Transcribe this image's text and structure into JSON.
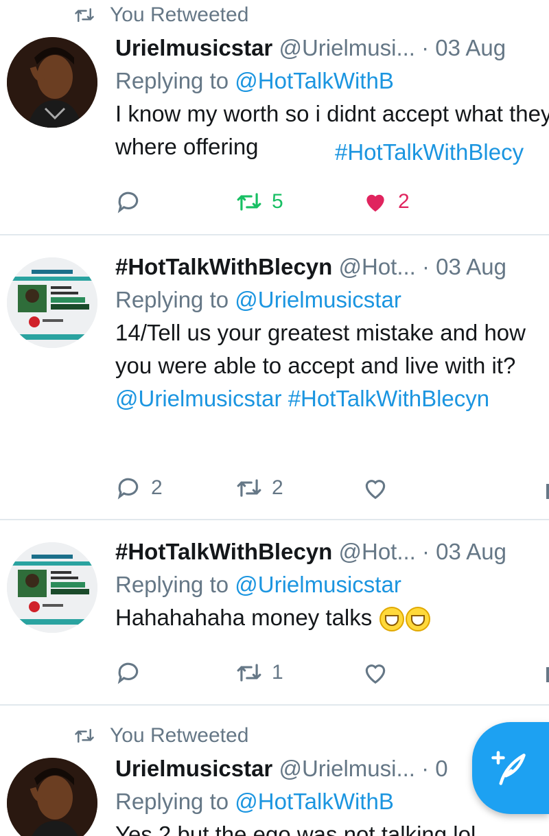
{
  "tweets": [
    {
      "retweeted_label": "You Retweeted",
      "name": "Urielmusicstar",
      "handle": "@Urielmusi...",
      "date": "· 03 Aug",
      "replying_prefix": "Replying to",
      "replying_to": "@HotTalkWithB",
      "text_plain": "I know my worth so i didnt accept what they where offering",
      "text_hashtag": "#HotTalkWithBlecy",
      "reply_count": "",
      "retweet_count": "5",
      "like_count": "2",
      "avatar_icon": "profile-photo-woman",
      "liked": true,
      "retweeted": true
    },
    {
      "name": "#HotTalkWithBlecyn",
      "handle": "@Hot...",
      "date": "· 03 Aug",
      "replying_prefix": "Replying to",
      "replying_to": "@Urielmusicstar",
      "text_plain": "14/Tell us your greatest mistake and how you were able to accept and live with it?",
      "text_mention": "@Urielmusicstar",
      "text_hashtag": "#HotTalkWithBlecyn",
      "reply_count": "2",
      "retweet_count": "2",
      "like_count": "",
      "avatar_icon": "show-flyer-avatar"
    },
    {
      "name": "#HotTalkWithBlecyn",
      "handle": "@Hot...",
      "date": "· 03 Aug",
      "replying_prefix": "Replying to",
      "replying_to": "@Urielmusicstar",
      "text_plain": "Hahahahaha money talks",
      "reply_count": "",
      "retweet_count": "1",
      "like_count": "",
      "avatar_icon": "show-flyer-avatar",
      "emojis": [
        "grinning-squinting-face",
        "grinning-squinting-face"
      ]
    },
    {
      "retweeted_label": "You Retweeted",
      "name": "Urielmusicstar",
      "handle": "@Urielmusi...",
      "date": "· 0",
      "replying_prefix": "Replying to",
      "replying_to": "@HotTalkWithB",
      "text_plain": "Yes 2 but the ego was not talking lol",
      "avatar_icon": "profile-photo-woman"
    }
  ],
  "fab": {
    "icon": "compose-tweet-icon"
  },
  "colors": {
    "link": "#1b95e0",
    "retweet_green": "#17bf63",
    "like_red": "#e0245e",
    "muted": "#657786",
    "fab": "#1da1f2"
  }
}
